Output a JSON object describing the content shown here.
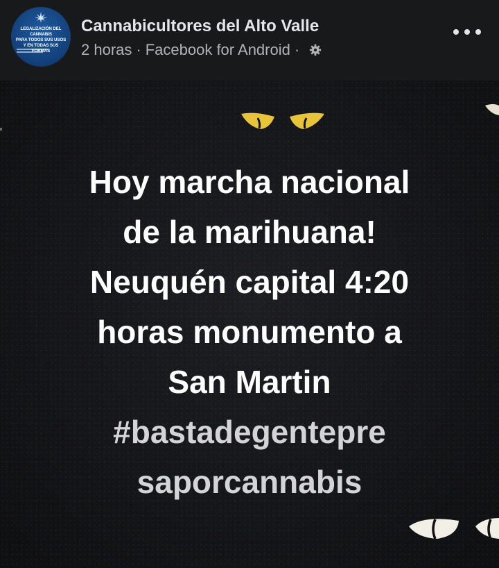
{
  "post": {
    "page_name": "Cannabicultores del Alto Valle",
    "time": "2 horas",
    "separator": "·",
    "source": "Facebook for Android",
    "privacy_icon": "gear-icon",
    "more_icon": "more-options-icon",
    "avatar": {
      "lines": "LEGALIZACIÓN DEL CANNABIS\nPARA TODOS SUS USOS\nY EN TODAS SUS FORMAS",
      "icon": "cannabis-leaf-icon"
    }
  },
  "image": {
    "lines": [
      "Hoy marcha nacional",
      "de la marihuana!",
      "Neuquén capital 4:20",
      "horas monumento a",
      "San Martin"
    ],
    "hashtag_lines": [
      "#bastadegentepre",
      "saporcannabis"
    ]
  },
  "colors": {
    "header_bg": "#18191b",
    "image_bg": "#141518",
    "text_primary": "#ffffff",
    "text_secondary": "#b0b3b8",
    "eye_yellow": "#e8c43a",
    "eye_white": "#f2efe6"
  }
}
